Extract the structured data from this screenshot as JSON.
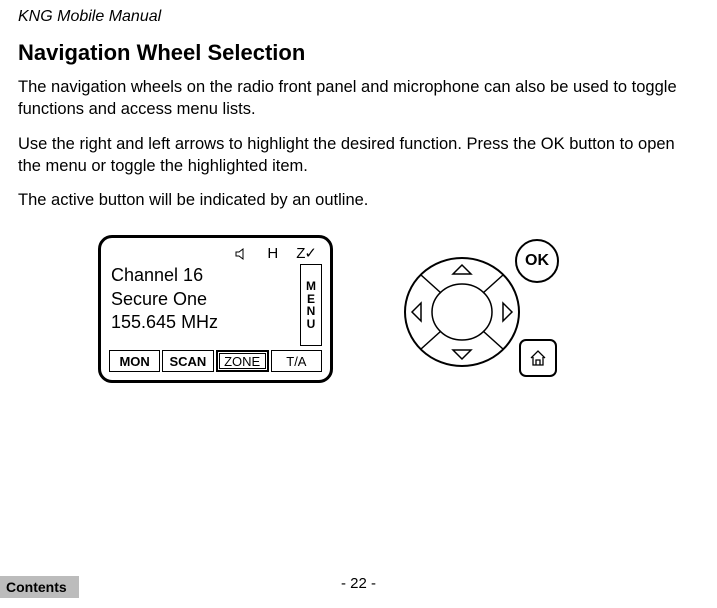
{
  "header": {
    "title": "KNG Mobile Manual"
  },
  "section": {
    "heading": "Navigation Wheel Selection"
  },
  "paragraphs": {
    "p1": "The navigation wheels on the radio front panel and microphone can also be used to toggle functions and access menu lists.",
    "p2": "Use the right and left arrows to highlight the desired function. Press the OK button to open the menu or toggle the highlighted item.",
    "p3": "The active button will be indicated by an outline."
  },
  "radio": {
    "status": {
      "h": "H",
      "z": "Z✓"
    },
    "channel": {
      "line1": "Channel 16",
      "line2": "Secure One",
      "line3": "155.645 MHz"
    },
    "menu": {
      "m": "M",
      "e": "E",
      "n": "N",
      "u": "U"
    },
    "softkeys": {
      "k1": "MON",
      "k2": "SCAN",
      "k3": "ZONE",
      "k4": "T/A"
    }
  },
  "controls": {
    "ok": "OK"
  },
  "footer": {
    "page": "- 22 -",
    "contents": "Contents"
  }
}
